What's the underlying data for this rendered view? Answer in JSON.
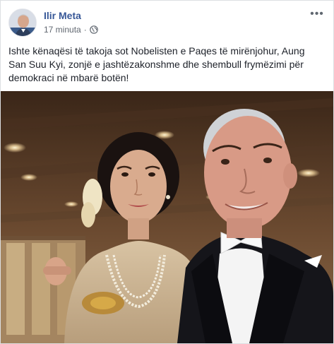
{
  "post": {
    "author": "Ilir Meta",
    "time": "17 minuta",
    "separator": "·",
    "privacy_icon": "globe-icon",
    "more_icon": "more-options-icon",
    "more_glyph": "•••",
    "text": "Ishte kënaqësi të takoja sot Nobelisten e Paqes të mirënjohur, Aung San Suu Kyi, zonjë e jashtëzakonshme dhe shembull frymëzimi për demokraci në mbarë botën!"
  },
  "colors": {
    "author_link": "#385898",
    "meta_text": "#606770",
    "body_text": "#1d2129"
  }
}
